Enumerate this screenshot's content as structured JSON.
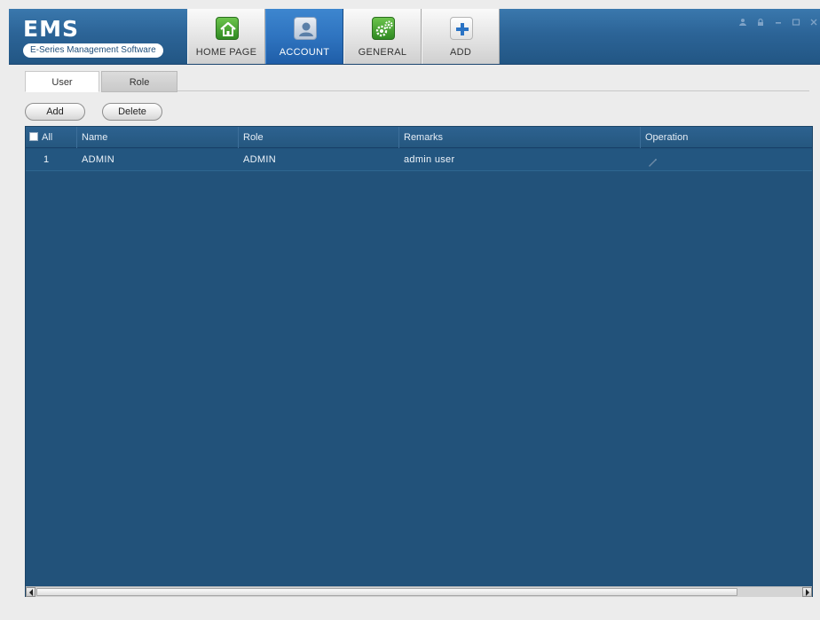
{
  "app": {
    "logo_title": "EMS",
    "logo_subtitle": "E-Series Management Software"
  },
  "nav": {
    "tabs": [
      {
        "label": "HOME PAGE",
        "icon": "home-icon",
        "active": false
      },
      {
        "label": "ACCOUNT",
        "icon": "user-account-icon",
        "active": true
      },
      {
        "label": "GENERAL",
        "icon": "gears-icon",
        "active": false
      },
      {
        "label": "ADD",
        "icon": "plus-icon",
        "active": false
      }
    ]
  },
  "window_controls": {
    "icons": [
      "user-icon",
      "lock-icon",
      "minimize-icon",
      "maximize-icon",
      "close-icon"
    ]
  },
  "subtabs": {
    "user_label": "User",
    "role_label": "Role",
    "active": "User"
  },
  "actions": {
    "add_label": "Add",
    "delete_label": "Delete"
  },
  "table": {
    "columns": {
      "all": "All",
      "name": "Name",
      "role": "Role",
      "remarks": "Remarks",
      "operation": "Operation"
    },
    "rows": [
      {
        "no": "1",
        "name": "ADMIN",
        "role": "ADMIN",
        "remarks": "admin user",
        "operation_icon": "edit-pencil-icon"
      }
    ]
  },
  "colors": {
    "titlebar": "#2c6497",
    "active_tab": "#2f74c0",
    "table_bg": "#22527a",
    "home_icon_bg": "#3f9e2f",
    "general_icon_bg": "#3f9e2f"
  }
}
